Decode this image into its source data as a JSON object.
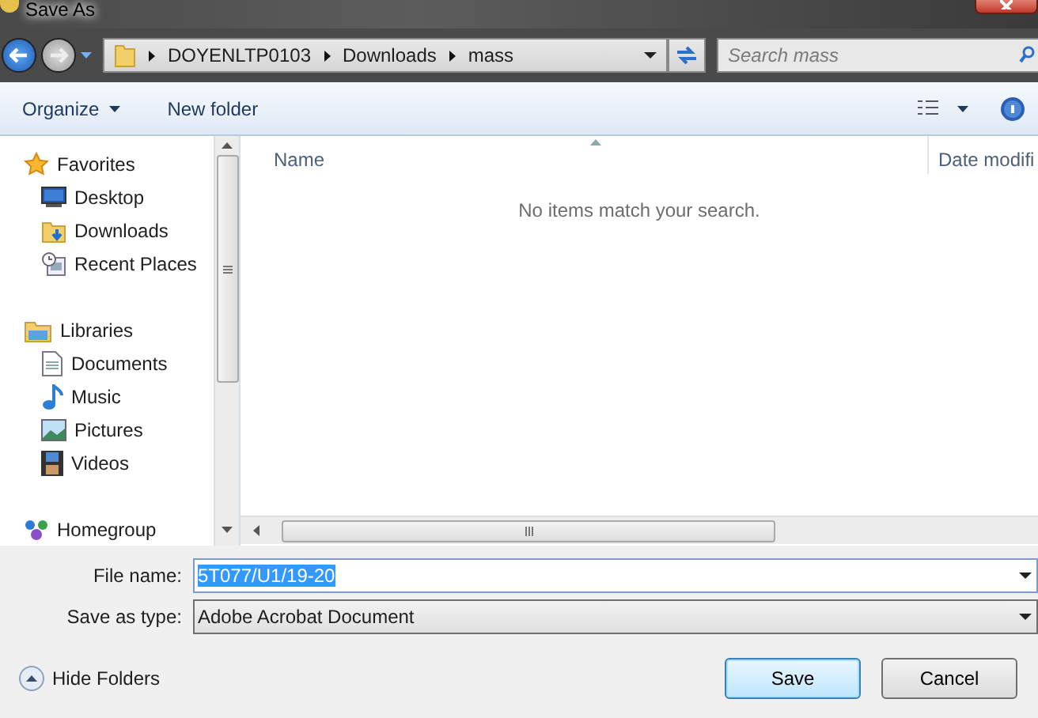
{
  "window": {
    "title": "Save As"
  },
  "address": {
    "crumbs": [
      "DOYENLTP0103",
      "Downloads",
      "mass"
    ]
  },
  "search": {
    "placeholder": "Search mass"
  },
  "toolbar": {
    "organize": "Organize",
    "new_folder": "New folder"
  },
  "sidebar": {
    "groups": [
      {
        "label": "Favorites",
        "kind": "favorites",
        "children": [
          {
            "label": "Desktop",
            "kind": "desktop"
          },
          {
            "label": "Downloads",
            "kind": "downloads"
          },
          {
            "label": "Recent Places",
            "kind": "recent"
          }
        ]
      },
      {
        "label": "Libraries",
        "kind": "libraries",
        "children": [
          {
            "label": "Documents",
            "kind": "documents"
          },
          {
            "label": "Music",
            "kind": "music"
          },
          {
            "label": "Pictures",
            "kind": "pictures"
          },
          {
            "label": "Videos",
            "kind": "videos"
          }
        ]
      },
      {
        "label": "Homegroup",
        "kind": "homegroup"
      }
    ]
  },
  "file_list": {
    "columns": [
      "Name",
      "Date modifi"
    ],
    "empty_message": "No items match your search."
  },
  "form": {
    "file_name_label": "File name:",
    "file_name": "5T077/U1/19-20",
    "file_name_selected": true,
    "type_label": "Save as type:",
    "type": "Adobe Acrobat Document"
  },
  "hide_folders": "Hide Folders",
  "buttons": [
    {
      "label": "Save",
      "kind": "default"
    },
    {
      "label": "Cancel",
      "kind": "normal"
    }
  ]
}
